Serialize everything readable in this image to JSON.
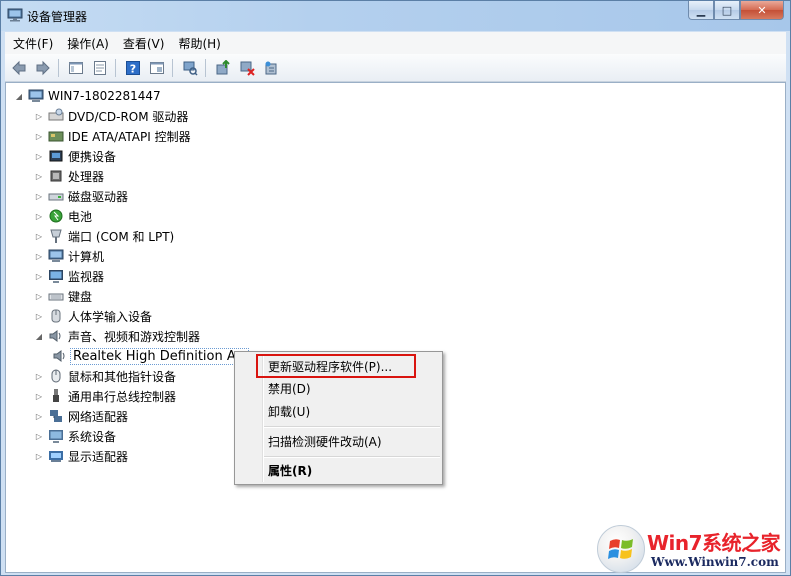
{
  "window": {
    "title": "设备管理器"
  },
  "menubar": {
    "items": [
      "文件(F)",
      "操作(A)",
      "查看(V)",
      "帮助(H)"
    ]
  },
  "toolbar": {
    "icons": [
      "back-arrow-icon",
      "forward-arrow-icon",
      "show-hide-tree-icon",
      "properties-icon",
      "help-icon",
      "update-driver-icon",
      "scan-hardware-icon",
      "update-driver-software-icon",
      "disable-device-icon",
      "uninstall-device-icon"
    ]
  },
  "tree": {
    "root": "WIN7-1802281447",
    "nodes": [
      {
        "label": "DVD/CD-ROM 驱动器",
        "expanded": false
      },
      {
        "label": "IDE ATA/ATAPI 控制器",
        "expanded": false
      },
      {
        "label": "便携设备",
        "expanded": false
      },
      {
        "label": "处理器",
        "expanded": false
      },
      {
        "label": "磁盘驱动器",
        "expanded": false
      },
      {
        "label": "电池",
        "expanded": false
      },
      {
        "label": "端口 (COM 和 LPT)",
        "expanded": false
      },
      {
        "label": "计算机",
        "expanded": false
      },
      {
        "label": "监视器",
        "expanded": false
      },
      {
        "label": "键盘",
        "expanded": false
      },
      {
        "label": "人体学输入设备",
        "expanded": false
      },
      {
        "label": "声音、视频和游戏控制器",
        "expanded": true
      },
      {
        "label": "Realtek High Definition Au",
        "child": true,
        "selected": true
      },
      {
        "label": "鼠标和其他指针设备",
        "expanded": false
      },
      {
        "label": "通用串行总线控制器",
        "expanded": false
      },
      {
        "label": "网络适配器",
        "expanded": false
      },
      {
        "label": "系统设备",
        "expanded": false
      },
      {
        "label": "显示适配器",
        "expanded": false
      }
    ]
  },
  "context_menu": {
    "items": [
      "更新驱动程序软件(P)...",
      "禁用(D)",
      "卸载(U)",
      "扫描检测硬件改动(A)",
      "属性(R)"
    ],
    "highlighted": "更新驱动程序软件(P)..."
  },
  "watermark": {
    "brand": "Win7系统之家",
    "url": "Www.Winwin7.com"
  },
  "colors": {
    "highlight_box": "#d9140f",
    "selection_border": "#6b9bd3"
  }
}
